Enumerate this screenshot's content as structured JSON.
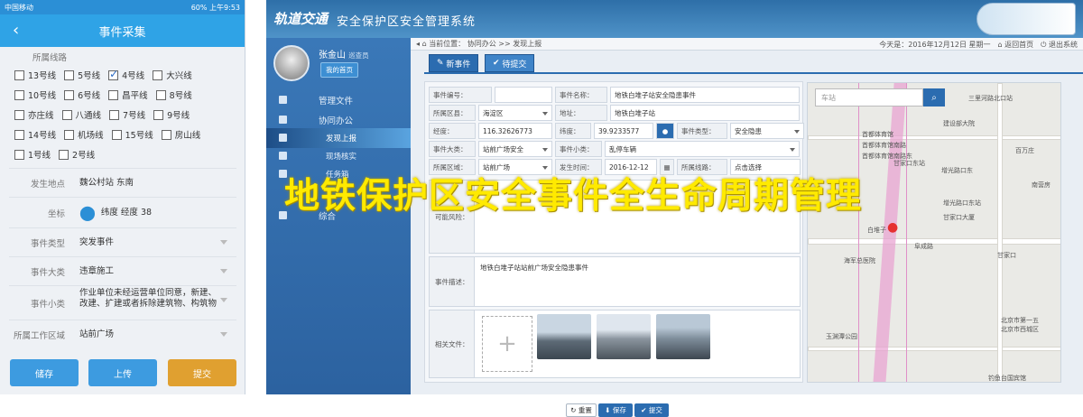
{
  "phone": {
    "status": {
      "carrier": "中国移动",
      "battery": "60%",
      "time": "上午9:53"
    },
    "title": "事件采集",
    "line_section_label": "所属线路",
    "lines": [
      [
        {
          "label": "13号线",
          "checked": false
        },
        {
          "label": "5号线",
          "checked": false
        },
        {
          "label": "4号线",
          "checked": true
        },
        {
          "label": "大兴线",
          "checked": false
        }
      ],
      [
        {
          "label": "10号线",
          "checked": false
        },
        {
          "label": "6号线",
          "checked": false
        },
        {
          "label": "昌平线",
          "checked": false
        },
        {
          "label": "8号线",
          "checked": false
        }
      ],
      [
        {
          "label": "亦庄线",
          "checked": false
        },
        {
          "label": "八通线",
          "checked": false
        },
        {
          "label": "7号线",
          "checked": false
        },
        {
          "label": "9号线",
          "checked": false
        }
      ],
      [
        {
          "label": "14号线",
          "checked": false
        },
        {
          "label": "机场线",
          "checked": false
        },
        {
          "label": "15号线",
          "checked": false
        },
        {
          "label": "房山线",
          "checked": false
        }
      ],
      [
        {
          "label": "1号线",
          "checked": false
        },
        {
          "label": "2号线",
          "checked": false
        }
      ]
    ],
    "fields": {
      "location_label": "发生地点",
      "location_value": "魏公村站 东南",
      "coord_label": "坐标",
      "coord_value": "纬度  经度  38",
      "event_type_label": "事件类型",
      "event_type_value": "突发事件",
      "event_cat_label": "事件大类",
      "event_cat_value": "违章施工",
      "event_sub_label": "事件小类",
      "event_sub_value": "作业单位未经运营单位同意，新建、改建、扩建或者拆除建筑物、构筑物",
      "area_label": "所属工作区域",
      "area_value": "站前广场"
    },
    "buttons": {
      "save": "储存",
      "upload": "上传",
      "submit": "提交"
    },
    "colors": {
      "save": "#3d9be0",
      "upload": "#3d9be0",
      "submit": "#e0a030"
    }
  },
  "web": {
    "logo": "轨道交通",
    "system_title": "安全保护区安全管理系统",
    "user": {
      "name": "张金山",
      "role": "巡查员",
      "home_button": "我的首页"
    },
    "nav": [
      {
        "label": "管理文件",
        "sub": false,
        "active": false
      },
      {
        "label": "协同办公",
        "sub": false,
        "active": false
      },
      {
        "label": "发现上报",
        "sub": true,
        "active": true
      },
      {
        "label": "现场核实",
        "sub": true,
        "active": false
      },
      {
        "label": "任务箱",
        "sub": true,
        "active": false
      },
      {
        "label": "综合",
        "sub": false,
        "active": false
      }
    ],
    "breadcrumb": {
      "prefix": "当前位置：",
      "items": "协同办公 >> 发现上报"
    },
    "today": "今天是：2016年12月12日 星期一",
    "return_home": "返回首页",
    "logout": "退出系统",
    "tabs": {
      "new_event": "新事件",
      "pending": "待提交"
    },
    "form": {
      "event_no_label": "事件编号：",
      "event_no_value": "",
      "event_name_label": "事件名称：",
      "event_name_value": "地铁白堆子站安全隐患事件",
      "district_label": "所属区县：",
      "district_value": "海淀区",
      "address_label": "地址：",
      "address_value": "地铁白堆子站",
      "lng_label": "经度：",
      "lng_value": "116.32626773",
      "lat_label": "纬度：",
      "lat_value": "39.9233577",
      "type_label": "事件类型：",
      "type_value": "安全隐患",
      "cat_label": "事件大类：",
      "cat_value": "站前广场安全",
      "sub_label": "事件小类：",
      "sub_value": "乱停车辆",
      "area_label": "所属区域：",
      "area_value": "站前广场",
      "time_label": "发生时间：",
      "time_value": "2016-12-12",
      "line_label": "所属线路：",
      "line_value": "点击选择",
      "risk_label": "可能风险：",
      "desc_label": "事件描述：",
      "desc_value": "地铁白堆子站站前广场安全隐患事件",
      "files_label": "相关文件："
    },
    "form_buttons": {
      "reset": "重置",
      "save": "保存",
      "submit": "提交"
    },
    "map": {
      "search_placeholder": "车站",
      "labels": [
        "三里河路北口站",
        "建设部大院",
        "首都体育馆",
        "首都体育馆南路",
        "首都体育馆南路东",
        "甘家口东站",
        "增光路口东",
        "增光路口东站",
        "甘家口大厦",
        "白堆子",
        "阜成路",
        "海军总医院",
        "甘家口",
        "玉渊潭公园",
        "北京市第一五",
        "北京市西城区",
        "钓鱼台国宾馆",
        "百万庄",
        "南营房"
      ]
    }
  },
  "overlay_title": "地铁保护区安全事件全生命周期管理"
}
